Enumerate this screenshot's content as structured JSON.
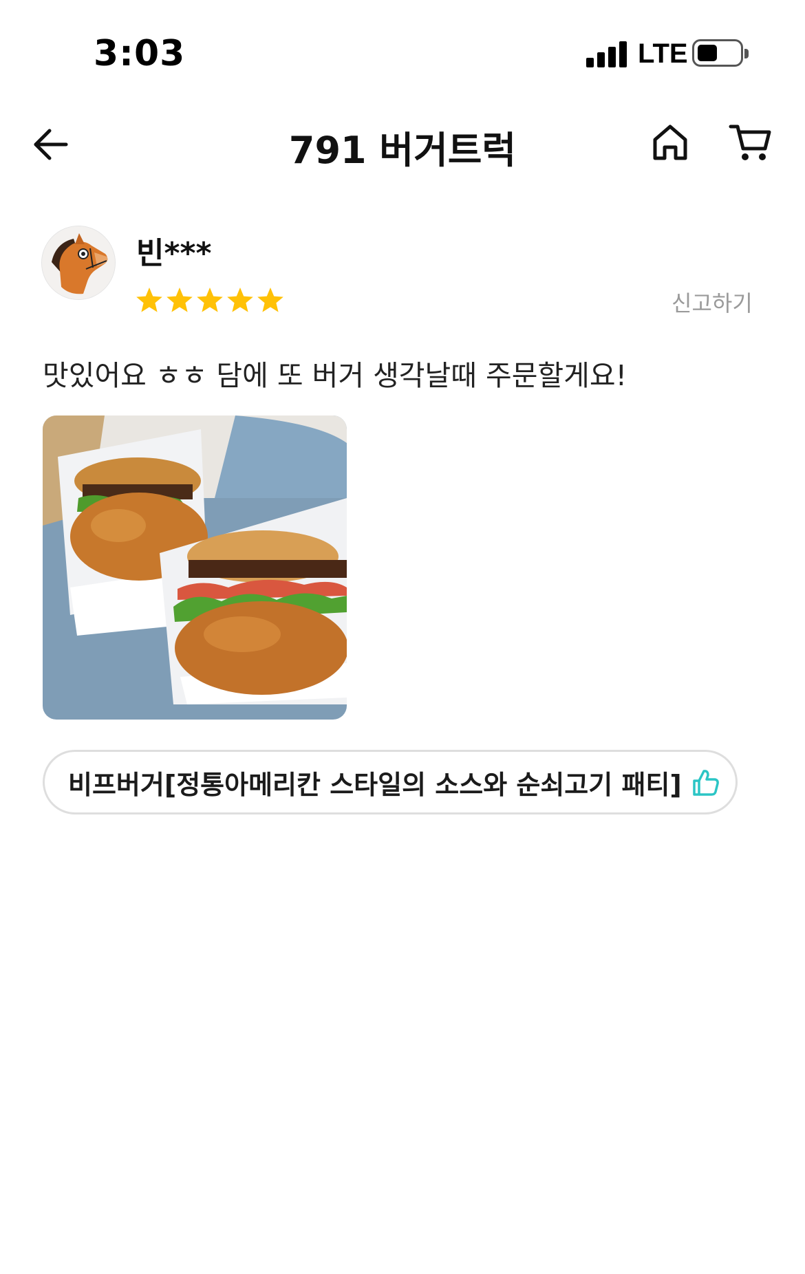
{
  "status_bar": {
    "time": "3:03",
    "network": "LTE",
    "signal_bars": 4,
    "battery_level": 0.45
  },
  "header": {
    "title": "791 버거트럭",
    "back_icon": "arrow-left-icon",
    "home_icon": "home-icon",
    "cart_icon": "cart-icon"
  },
  "review": {
    "reviewer_name": "빈***",
    "rating": 5,
    "rating_max": 5,
    "report_label": "신고하기",
    "text": "맛있어요 ㅎㅎ 담에 또 버거 생각날때 주문할게요!",
    "photo_icon": "burger-photo",
    "menu_tag": {
      "label": "비프버거[정통아메리칸 스타일의 소스와 순쇠고기 패티]",
      "icon": "thumbs-up-icon"
    }
  },
  "colors": {
    "star": "#FFC107",
    "thumb": "#2BC5C5",
    "muted_text": "#9A9A9A",
    "tag_border": "#DEDEDE"
  }
}
